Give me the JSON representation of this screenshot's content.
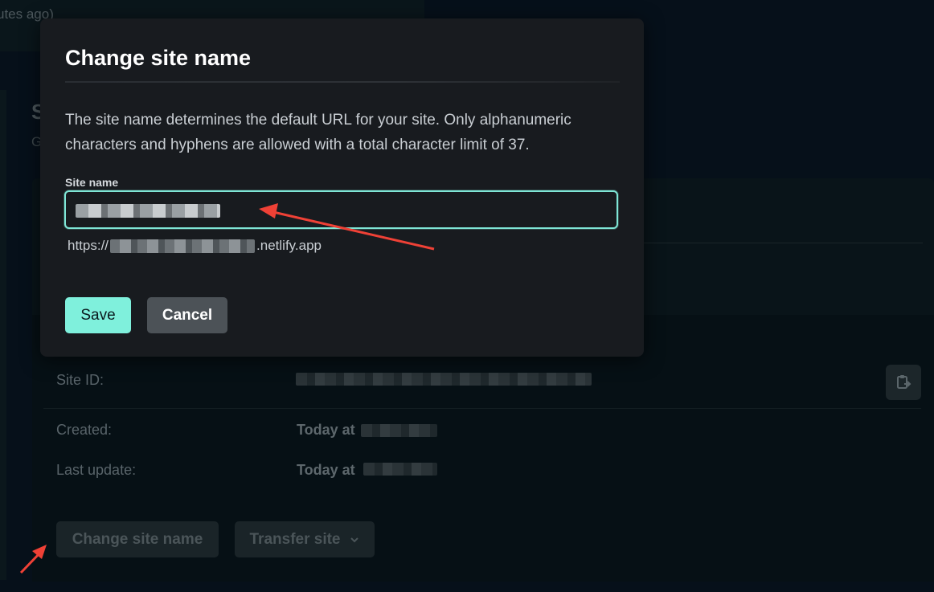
{
  "background": {
    "top_card_text": "utes ago)",
    "section_title": "S",
    "section_subtitle": "G",
    "rows": [
      {
        "label": "Site ID:",
        "value": ""
      },
      {
        "label": "Created:",
        "value": "Today at"
      },
      {
        "label": "Last update:",
        "value": "Today at"
      }
    ],
    "buttons": {
      "change_site_name": "Change site name",
      "transfer_site": "Transfer site"
    }
  },
  "modal": {
    "title": "Change site name",
    "description": "The site name determines the default URL for your site. Only alphanumeric characters and hyphens are allowed with a total character limit of 37.",
    "field_label": "Site name",
    "url_prefix": "https://",
    "url_suffix": ".netlify.app",
    "save_label": "Save",
    "cancel_label": "Cancel"
  },
  "colors": {
    "accent": "#7ff0dc",
    "modal_bg": "#181b1f",
    "annotation_arrow": "#ef4136"
  },
  "icons": {
    "copy": "clipboard-copy-icon",
    "dropdown": "chevron-down-icon"
  }
}
